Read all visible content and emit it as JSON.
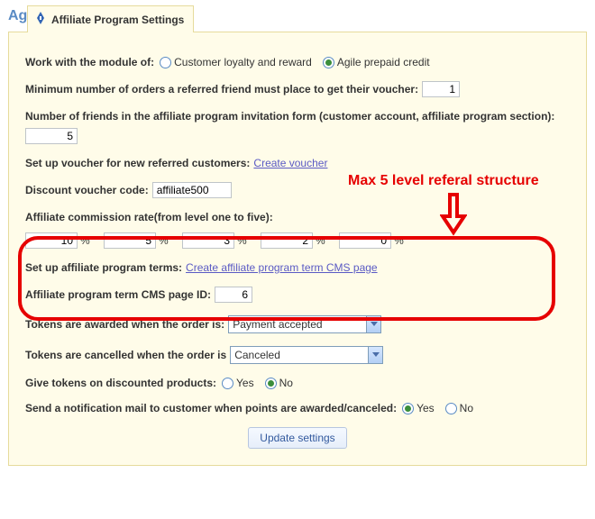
{
  "title": "Agile Affiliate module",
  "tab": {
    "label": "Affiliate Program Settings"
  },
  "workWith": {
    "label": "Work with the module of:",
    "opt1": "Customer loyalty and reward",
    "opt2": "Agile prepaid credit",
    "selected": "opt2"
  },
  "minOrders": {
    "label": "Minimum number of orders a referred friend must place to get their voucher:",
    "value": "1"
  },
  "friendsCount": {
    "label": "Number of friends in the affiliate program invitation form (customer account, affiliate program section):",
    "value": "5"
  },
  "voucherSetup": {
    "label": "Set up voucher for new referred customers:",
    "linkText": "Create voucher"
  },
  "discountCode": {
    "label": "Discount voucher code:",
    "value": "affiliate500"
  },
  "commission": {
    "label": "Affiliate commission rate(from level one to five):",
    "values": [
      "10",
      "5",
      "3",
      "2",
      "0"
    ],
    "unit": "%"
  },
  "termSetup": {
    "label": "Set up affiliate program terms:",
    "linkText": "Create affiliate program term CMS page"
  },
  "termPageId": {
    "label": "Affiliate program term CMS page ID:",
    "value": "6"
  },
  "awarded": {
    "label": "Tokens are awarded when the order is:",
    "selected": "Payment accepted"
  },
  "cancelled": {
    "label": "Tokens are cancelled when the order is",
    "selected": "Canceled"
  },
  "discounted": {
    "label": "Give tokens on discounted products:",
    "yes": "Yes",
    "no": "No",
    "selected": "no"
  },
  "notify": {
    "label": "Send a notification mail to customer when points are awarded/canceled:",
    "yes": "Yes",
    "no": "No",
    "selected": "yes"
  },
  "updateBtn": "Update settings",
  "annotation": {
    "text": "Max 5 level referal structure"
  }
}
